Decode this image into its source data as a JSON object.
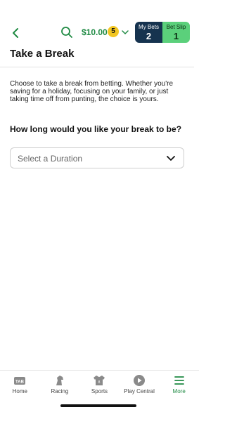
{
  "header": {
    "balance": "$10.00",
    "notification_count": "5",
    "my_bets_label": "My Bets",
    "my_bets_count": "2",
    "bet_slip_label": "Bet Slip",
    "bet_slip_count": "1",
    "accent_color": "#1f8a43"
  },
  "page": {
    "title": "Take a Break",
    "description": "Choose to take a break from betting. Whether you're saving for a holiday, focusing on your family, or just taking time off from punting, the choice is yours.",
    "question": "How long would you like your break to be?"
  },
  "duration_select": {
    "placeholder": "Select a Duration"
  },
  "bottom_nav": {
    "items": [
      {
        "label": "Home",
        "icon": "tab-logo-icon"
      },
      {
        "label": "Racing",
        "icon": "horse-icon"
      },
      {
        "label": "Sports",
        "icon": "jersey-icon"
      },
      {
        "label": "Play Central",
        "icon": "play-icon"
      },
      {
        "label": "More",
        "icon": "menu-icon",
        "active": true
      }
    ]
  }
}
